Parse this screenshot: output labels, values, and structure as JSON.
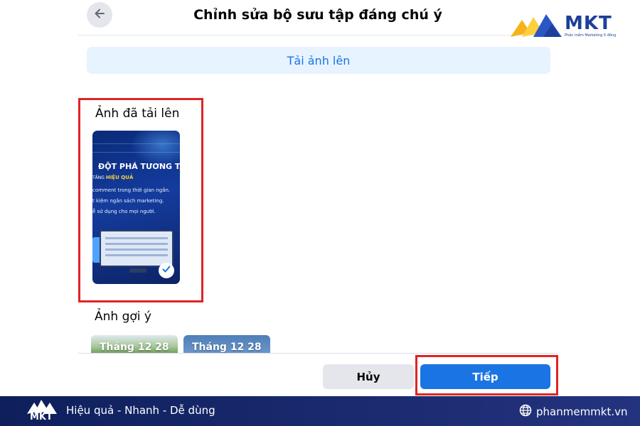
{
  "dialog": {
    "title": "Chỉnh sửa bộ sưu tập đáng chú ý",
    "back_icon": "arrow-left-icon",
    "upload_button_label": "Tải ảnh lên"
  },
  "uploaded": {
    "heading": "Ảnh đã tải lên",
    "thumbnail": {
      "title": "ĐỘT PHÁ TƯƠNG TÁC",
      "subtitle_prefix": "TĂNG",
      "subtitle_highlight": "HIỆU QUẢ",
      "lines": [
        "comment trong thời gian ngắn.",
        "t kiệm ngân sách marketing.",
        "ễ sử dụng cho mọi người."
      ],
      "selected": true,
      "check_icon": "checkmark-icon"
    }
  },
  "suggested": {
    "heading": "Ảnh gợi ý",
    "items": [
      {
        "label": "Tháng 12 28"
      },
      {
        "label": "Tháng 12 28"
      }
    ]
  },
  "footer": {
    "cancel_label": "Hủy",
    "next_label": "Tiếp"
  },
  "watermark": {
    "logo_text": "MKT",
    "logo_tagline": "Phần mềm Marketing 0 đồng"
  },
  "bottom_bar": {
    "logo_text": "MKT",
    "tagline": "Hiệu quả - Nhanh - Dễ dùng",
    "website": "phanmemmkt.vn",
    "globe_icon": "globe-icon"
  },
  "colors": {
    "accent": "#1b74e4",
    "highlight_border": "#e02424",
    "bottom_bar": "#1a2a6c"
  }
}
